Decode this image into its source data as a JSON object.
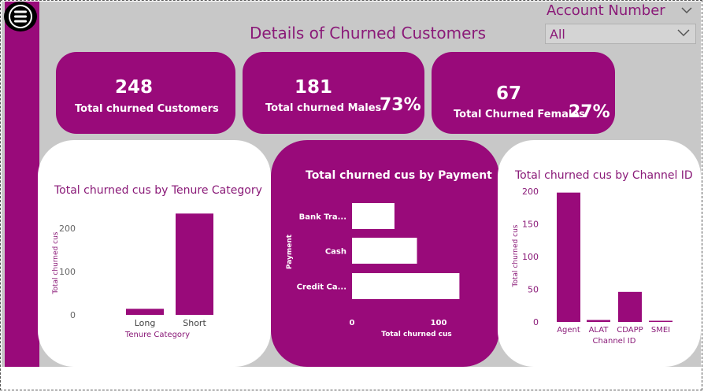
{
  "header": {
    "title": "Details of Churned Customers"
  },
  "slicer": {
    "label": "Account Number",
    "value": "All"
  },
  "kpis": {
    "total": {
      "value": "248",
      "label": "Total churned Customers"
    },
    "males": {
      "value": "181",
      "label": "Total churned Males",
      "pct": "73%"
    },
    "females": {
      "value": "67",
      "label": "Total Churned Females",
      "pct": "27%"
    }
  },
  "colors": {
    "accent": "#990a7a",
    "background": "#c8c8c8",
    "panel": "#ffffff"
  },
  "icons": {
    "menu": "hamburger-menu-icon",
    "dropdown": "chevron-down-icon"
  },
  "chart_data": [
    {
      "type": "bar",
      "title": "Total churned cus by Tenure Category",
      "xlabel": "Tenure Category",
      "ylabel": "Total churned cus",
      "categories": [
        "Long",
        "Short"
      ],
      "values": [
        14,
        234
      ],
      "ylim": [
        0,
        240
      ],
      "yticks": [
        0,
        100,
        200
      ]
    },
    {
      "type": "bar",
      "orientation": "horizontal",
      "title": "Total churned cus by Payment",
      "xlabel": "Total churned cus",
      "ylabel": "Payment",
      "categories": [
        "Bank Tra...",
        "Cash",
        "Credit Ca..."
      ],
      "values": [
        49,
        75,
        124
      ],
      "xlim": [
        0,
        130
      ],
      "xticks": [
        0,
        100
      ]
    },
    {
      "type": "bar",
      "title": "Total churned cus by Channel ID",
      "xlabel": "Channel ID",
      "ylabel": "Total churned cus",
      "categories": [
        "Agent",
        "ALAT",
        "CDAPP",
        "SMEI"
      ],
      "values": [
        198,
        3,
        46,
        1
      ],
      "ylim": [
        0,
        200
      ],
      "yticks": [
        0,
        50,
        100,
        150,
        200
      ]
    }
  ]
}
